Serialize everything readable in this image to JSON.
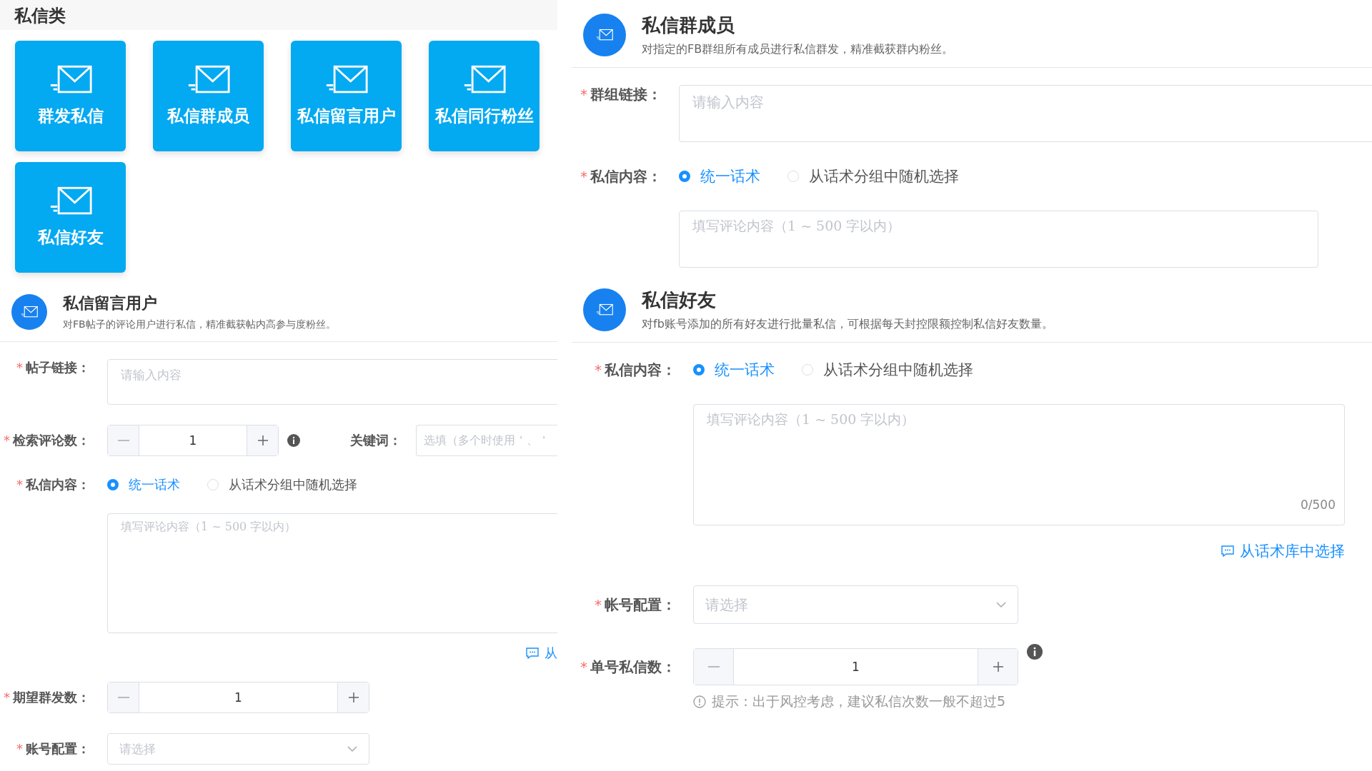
{
  "left": {
    "category": {
      "title": "私信类",
      "tiles": [
        {
          "label": "群发私信"
        },
        {
          "label": "私信群成员"
        },
        {
          "label": "私信留言用户"
        },
        {
          "label": "私信同行粉丝"
        },
        {
          "label": "私信好友"
        }
      ]
    },
    "panels": [
      {
        "title": "私信留言用户",
        "description": "对FB帖子的评论用户进行私信，精准截获帖内高参与度粉丝。",
        "rows": [
          {
            "kind": "input",
            "mark": "*",
            "label": "帖子链接：",
            "placeholder": "请输入内容"
          },
          {
            "kind": "number",
            "mark": "*",
            "label": "检索评论数：",
            "value": "1",
            "info": true,
            "extra": {
              "label": "关键词：",
              "placeholder": "选填（多个时使用＇、＇"
            }
          },
          {
            "kind": "radio",
            "mark": "*",
            "label": "私信内容：",
            "options": [
              {
                "label": "统一话术",
                "selected": true
              },
              {
                "label": "从话术分组中随机选择",
                "selected": false
              }
            ]
          },
          {
            "kind": "textarea",
            "placeholder": "填写评论内容（1 ~ 500 字以内）"
          },
          {
            "kind": "link",
            "text": "从"
          },
          {
            "kind": "number",
            "mark": "*",
            "label": "期望群发数：",
            "value": "1",
            "info": false
          },
          {
            "kind": "select",
            "mark": "*",
            "label": "账号配置：",
            "placeholder": "请选择"
          }
        ]
      }
    ]
  },
  "right": {
    "panels": [
      {
        "title": "私信群成员",
        "description": "对指定的FB群组所有成员进行私信群发，精准截获群内粉丝。",
        "rows": [
          {
            "kind": "input",
            "mark": "*",
            "label": "群组链接：",
            "placeholder": "请输入内容"
          },
          {
            "kind": "radio",
            "mark": "*",
            "label": "私信内容：",
            "options": [
              {
                "label": "统一话术",
                "selected": true
              },
              {
                "label": "从话术分组中随机选择",
                "selected": false
              }
            ]
          },
          {
            "kind": "textarea",
            "placeholder": "填写评论内容（1 ~ 500 字以内）"
          }
        ]
      },
      {
        "title": "私信好友",
        "description": "对fb账号添加的所有好友进行批量私信，可根据每天封控限额控制私信好友数量。",
        "rows": [
          {
            "kind": "radio",
            "mark": "*",
            "label": "私信内容：",
            "options": [
              {
                "label": "统一话术",
                "selected": true
              },
              {
                "label": "从话术分组中随机选择",
                "selected": false
              }
            ]
          },
          {
            "kind": "textarea",
            "placeholder": "填写评论内容（1 ~ 500 字以内）",
            "counter": "0/500"
          },
          {
            "kind": "link",
            "text": "从话术库中选择"
          },
          {
            "kind": "select",
            "mark": "*",
            "label": "帐号配置：",
            "placeholder": "请选择"
          },
          {
            "kind": "number",
            "mark": "*",
            "label": "单号私信数：",
            "value": "1",
            "info": true
          },
          {
            "kind": "hint",
            "text": "提示：出于风控考虑，建议私信次数一般不超过5"
          }
        ]
      }
    ]
  }
}
